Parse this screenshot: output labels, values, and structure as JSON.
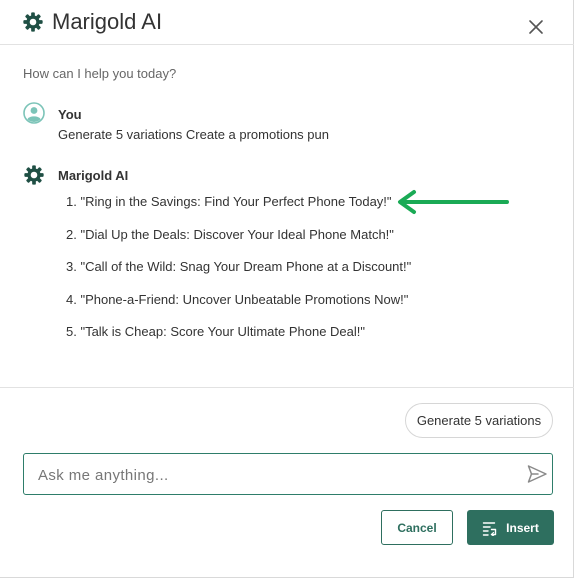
{
  "header": {
    "title": "Marigold AI",
    "logo_icon": "marigold-gear-icon",
    "close_icon": "close-icon"
  },
  "chat": {
    "prompt_hint": "How can I help you today?",
    "user": {
      "name": "You",
      "icon": "user-avatar-icon",
      "message": "Generate 5 variations Create a promotions pun"
    },
    "assistant": {
      "name": "Marigold AI",
      "icon": "marigold-gear-icon",
      "results": [
        "1. \"Ring in the Savings: Find Your Perfect Phone Today!\"",
        "2. \"Dial Up the Deals: Discover Your Ideal Phone Match!\"",
        "3. \"Call of the Wild: Snag Your Dream Phone at a Discount!\"",
        "4. \"Phone-a-Friend: Uncover Unbeatable Promotions Now!\"",
        "5. \"Talk is Cheap: Score Your Ultimate Phone Deal!\""
      ]
    },
    "annotation": {
      "icon": "green-arrow-icon",
      "color": "#1aaa55"
    }
  },
  "actions": {
    "generate_label": "Generate 5 variations",
    "input_placeholder": "Ask me anything...",
    "send_icon": "send-icon",
    "cancel_label": "Cancel",
    "insert_label": "Insert",
    "insert_icon": "insert-icon"
  },
  "colors": {
    "brand": "#2e6f5f",
    "brand_dark": "#1f4f44",
    "avatar": "#7cc4b8"
  }
}
